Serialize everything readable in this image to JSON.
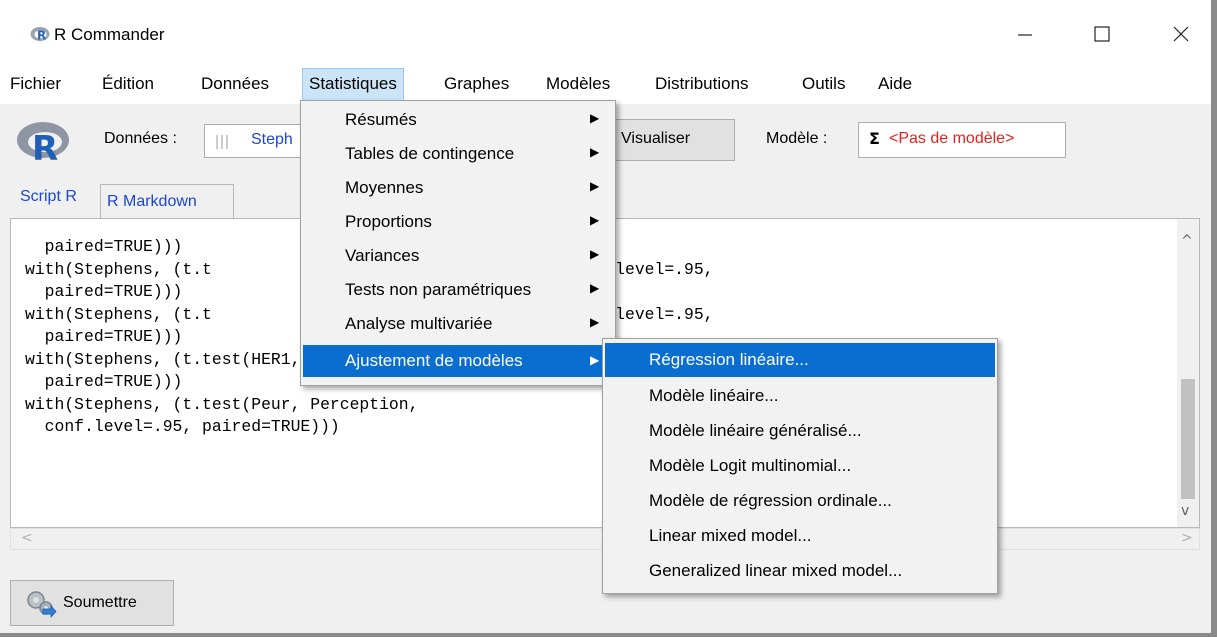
{
  "window": {
    "title": "R Commander"
  },
  "menubar": [
    {
      "label": "Fichier"
    },
    {
      "label": "Édition"
    },
    {
      "label": "Données"
    },
    {
      "label": "Statistiques"
    },
    {
      "label": "Graphes"
    },
    {
      "label": "Modèles"
    },
    {
      "label": "Distributions"
    },
    {
      "label": "Outils"
    },
    {
      "label": "Aide"
    }
  ],
  "toolbar": {
    "donnees_label": "Données :",
    "dataset_value": "Steph",
    "visualiser_label": "Visualiser",
    "modele_label": "Modèle :",
    "model_sigma": "Σ",
    "model_value": "<Pas de modèle>"
  },
  "tabs": {
    "script": "Script R",
    "markdown": "R Markdown"
  },
  "code_lines": [
    "  paired=TRUE)))",
    "with(Stephens, (t.t                native='two.sided', conf.level=.95,",
    "  paired=TRUE)))",
    "with(Stephens, (t.t                native='two.sided', conf.level=.95,",
    "  paired=TRUE)))",
    "with(Stephens, (t.test(HER1, HER2, alter                      vel=.95,",
    "  paired=TRUE)))",
    "with(Stephens, (t.test(Peur, Perception,",
    "  conf.level=.95, paired=TRUE)))"
  ],
  "soumettre_label": "Soumettre",
  "statistiques_menu": [
    {
      "label": "Résumés"
    },
    {
      "label": "Tables de contingence"
    },
    {
      "label": "Moyennes"
    },
    {
      "label": "Proportions"
    },
    {
      "label": "Variances"
    },
    {
      "label": "Tests non paramétriques"
    },
    {
      "label": "Analyse multivariée"
    },
    {
      "label": "Ajustement de modèles",
      "highlighted": true
    }
  ],
  "ajustement_submenu": [
    {
      "label": "Régression linéaire...",
      "highlighted": true
    },
    {
      "label": "Modèle linéaire..."
    },
    {
      "label": "Modèle linéaire généralisé..."
    },
    {
      "label": "Modèle Logit multinomial..."
    },
    {
      "label": "Modèle de régression ordinale..."
    },
    {
      "label": "Linear mixed model..."
    },
    {
      "label": "Generalized linear mixed model..."
    }
  ],
  "colors": {
    "highlight": "#0a6ed1",
    "menubar_active": "#cce4f7",
    "link_blue": "#1a47d6",
    "model_red": "#e81f1f"
  }
}
